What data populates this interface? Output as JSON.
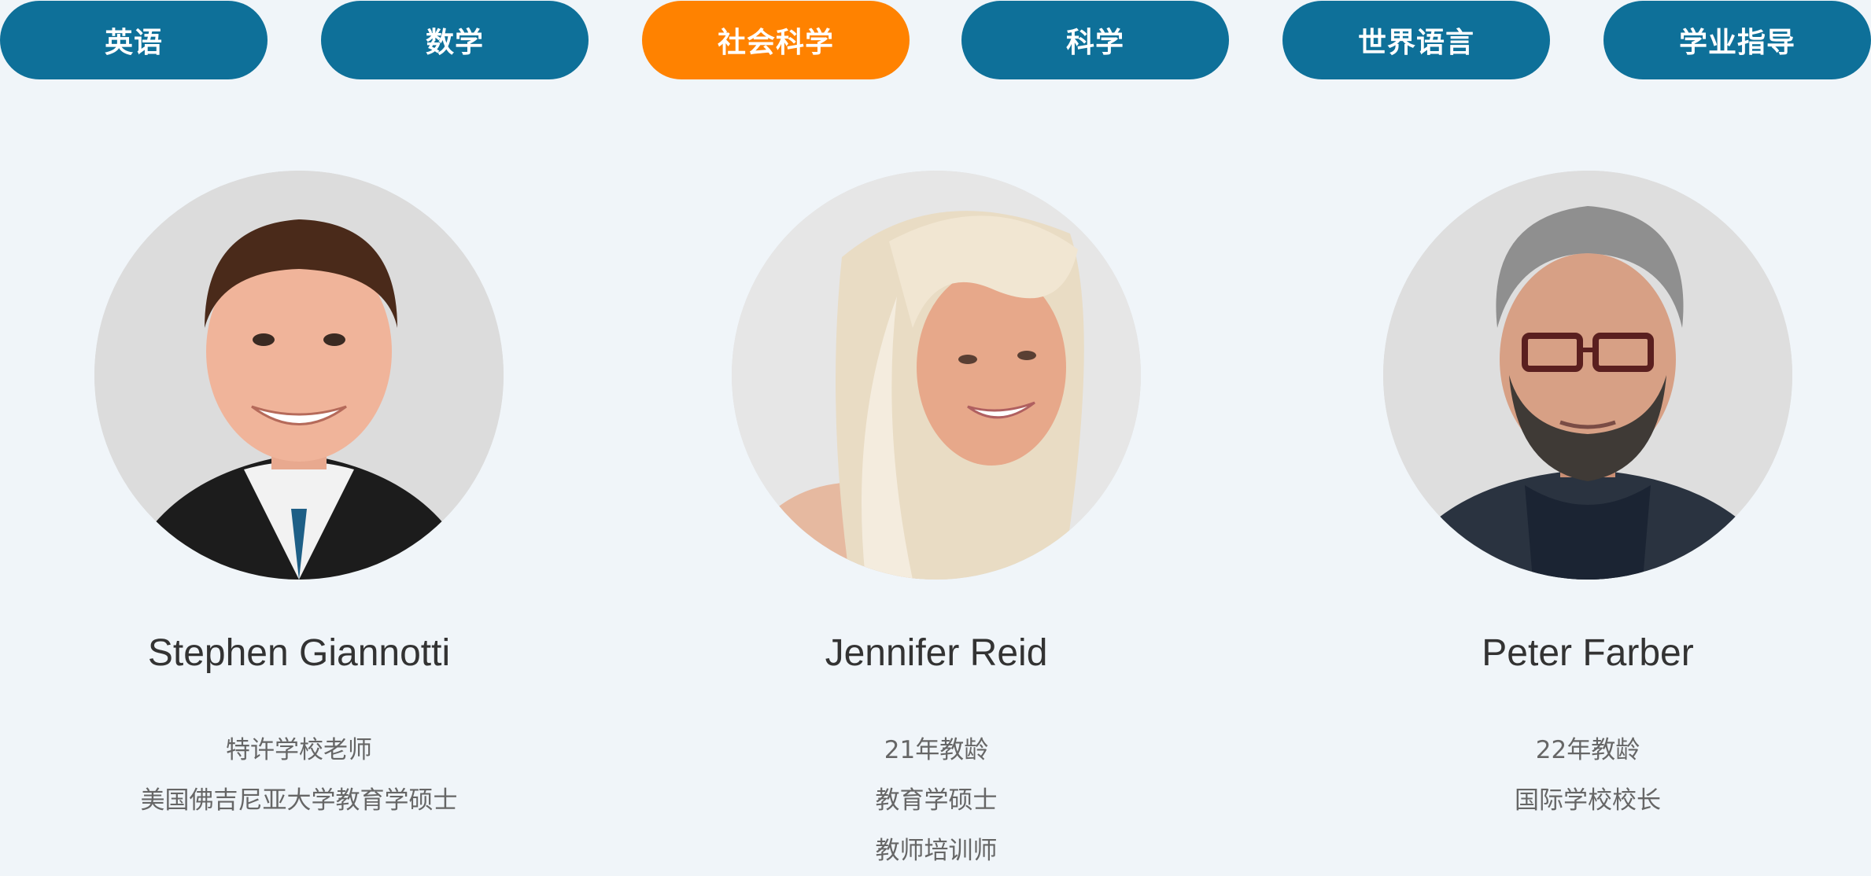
{
  "tabs": [
    {
      "label": "英语",
      "active": false
    },
    {
      "label": "数学",
      "active": false
    },
    {
      "label": "社会科学",
      "active": true
    },
    {
      "label": "科学",
      "active": false
    },
    {
      "label": "世界语言",
      "active": false
    },
    {
      "label": "学业指导",
      "active": false
    }
  ],
  "colors": {
    "tab_default": "#0e7099",
    "tab_active": "#ff8200",
    "background": "#f0f5f9"
  },
  "teachers": [
    {
      "name": "Stephen Giannotti",
      "details": [
        "特许学校老师",
        "美国佛吉尼亚大学教育学硕士"
      ],
      "photo": "portrait-photo"
    },
    {
      "name": "Jennifer Reid",
      "details": [
        "21年教龄",
        "教育学硕士",
        "教师培训师"
      ],
      "photo": "portrait-photo"
    },
    {
      "name": "Peter Farber",
      "details": [
        "22年教龄",
        "国际学校校长"
      ],
      "photo": "portrait-photo"
    }
  ]
}
